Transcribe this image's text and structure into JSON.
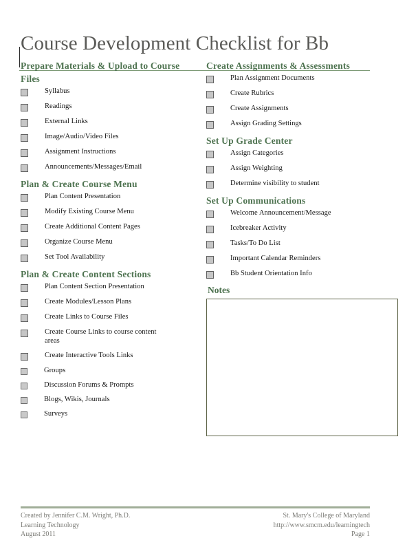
{
  "document": {
    "title": "Course Development Checklist for Bb",
    "accent_green": "#4e7350",
    "rule_green": "#7e9b77",
    "title_color": "#5a5a57",
    "checkbox_fill": "#c6c6c6",
    "notes_border": "#5e6448"
  },
  "left_column": {
    "sections": [
      {
        "heading": "Prepare Materials & Upload to Course Files",
        "items": [
          {
            "label": "Syllabus",
            "level": 1
          },
          {
            "label": "Readings",
            "level": 1
          },
          {
            "label": "External Links",
            "level": 1
          },
          {
            "label": "Image/Audio/Video Files",
            "level": 1
          },
          {
            "label": "Assignment Instructions",
            "level": 1
          },
          {
            "label": "Announcements/Messages/Email",
            "level": 1
          }
        ]
      },
      {
        "heading": "Plan & Create Course Menu",
        "items": [
          {
            "label": "Plan Content Presentation",
            "level": 1
          },
          {
            "label": "Modify Existing Course Menu",
            "level": 1
          },
          {
            "label": "Create Additional Content Pages",
            "level": 1
          },
          {
            "label": "Organize Course Menu",
            "level": 1
          },
          {
            "label": "Set Tool Availability",
            "level": 1
          }
        ]
      },
      {
        "heading": "Plan & Create Content Sections",
        "items": [
          {
            "label": "Plan Content Section Presentation",
            "level": 1
          },
          {
            "label": "Create Modules/Lesson Plans",
            "level": 1
          },
          {
            "label": "Create Links to Course Files",
            "level": 1
          },
          {
            "label": "Create Course Links to course content areas",
            "level": 1
          },
          {
            "label": "Create Interactive Tools Links",
            "level": 1
          },
          {
            "label": "Groups",
            "level": 2
          },
          {
            "label": "Discussion Forums & Prompts",
            "level": 2
          },
          {
            "label": "Blogs, Wikis, Journals",
            "level": 2
          },
          {
            "label": "Surveys",
            "level": 2
          }
        ]
      }
    ]
  },
  "right_column": {
    "sections": [
      {
        "heading": "Create Assignments & Assessments",
        "items": [
          {
            "label": "Plan Assignment Documents",
            "level": 1
          },
          {
            "label": "Create Rubrics",
            "level": 1
          },
          {
            "label": "Create Assignments",
            "level": 1
          },
          {
            "label": "Assign Grading Settings",
            "level": 1
          }
        ]
      },
      {
        "heading": "Set Up Grade Center",
        "items": [
          {
            "label": "Assign Categories",
            "level": 1
          },
          {
            "label": "Assign Weighting",
            "level": 1
          },
          {
            "label": "Determine visibility to student",
            "level": 1
          }
        ]
      },
      {
        "heading": "Set Up Communications",
        "items": [
          {
            "label": "Welcome Announcement/Message",
            "level": 1
          },
          {
            "label": "Icebreaker Activity",
            "level": 1
          },
          {
            "label": "Tasks/To Do List",
            "level": 1
          },
          {
            "label": "Important Calendar Reminders",
            "level": 1
          },
          {
            "label": "Bb Student Orientation Info",
            "level": 1
          }
        ]
      }
    ],
    "notes": {
      "heading": "Notes",
      "value": ""
    }
  },
  "footer": {
    "left": [
      "Created by Jennifer C.M. Wright, Ph.D.",
      "Learning Technology",
      "August 2011"
    ],
    "right": [
      "St. Mary's College of Maryland",
      "http://www.smcm.edu/learningtech",
      "Page 1"
    ]
  }
}
